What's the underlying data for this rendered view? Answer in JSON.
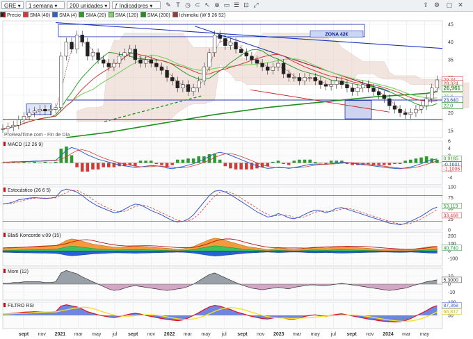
{
  "toolbar": {
    "symbol": "GRE",
    "timeframe": "1 semana",
    "units": "200 unidades",
    "indicators": "Indicadores"
  },
  "legend": [
    {
      "label": "Precio",
      "color": "#222222"
    },
    {
      "label": "SMA (40)",
      "color": "#d23a3a"
    },
    {
      "label": "SMA (4)",
      "color": "#2b62c4"
    },
    {
      "label": "SMA (20)",
      "color": "#2c9b2c"
    },
    {
      "label": "SMA (120)",
      "color": "#7fd36a"
    },
    {
      "label": "SMA (200)",
      "color": "#1f8f1f"
    },
    {
      "label": "Ichimoku (W 9 26 52)",
      "color": "#9a3b3b"
    }
  ],
  "colors": {
    "price": "#111111",
    "sma40": "#d23a3a",
    "sma4": "#2b62c4",
    "sma20": "#2c9b2c",
    "sma120": "#7fd36a",
    "sma200": "#1f8f1f",
    "kumo": "#e8cfc4",
    "trendline": "#1d35b8",
    "support": "#d40000",
    "zona": "#c9d6f5"
  },
  "chart_data": [
    {
      "type": "line",
      "panel": "price",
      "watermark": "ProRealTime.com - Fin de Día",
      "annotation": "ZONA 42€",
      "ylim": [
        13,
        46
      ],
      "yticks": [
        15,
        20,
        25,
        30,
        35,
        40,
        45
      ],
      "xlabels": [
        "sept",
        "nov",
        "2021",
        "mar",
        "may",
        "jul",
        "sept",
        "nov",
        "2022",
        "mar",
        "may",
        "jul",
        "sept",
        "nov",
        "2023",
        "mar",
        "may",
        "jul",
        "sept",
        "nov",
        "2024",
        "mar",
        "may"
      ],
      "value_labels": [
        "29,34",
        "28,324",
        "26,961",
        "24,8",
        "23,640",
        "22,0"
      ],
      "series": [
        {
          "name": "Precio",
          "x": [
            0,
            2,
            4,
            6,
            8,
            10,
            12,
            14,
            16,
            18,
            20,
            22,
            24,
            26,
            28,
            30,
            32,
            34,
            36,
            38,
            40,
            42,
            44,
            46,
            48,
            50,
            52,
            54,
            56,
            58,
            60,
            62,
            64,
            66,
            68,
            70,
            72,
            74,
            76,
            78,
            80,
            82,
            84,
            86,
            88,
            90,
            92,
            94,
            96,
            98,
            100,
            102,
            104,
            106,
            108,
            110,
            112,
            114,
            116,
            118,
            120,
            122,
            124,
            126,
            128,
            130,
            132,
            134,
            136,
            138,
            140,
            142,
            144,
            146,
            148,
            150,
            152,
            154,
            156,
            158,
            160,
            162,
            164
          ],
          "values": [
            15.5,
            16,
            16.5,
            18,
            19,
            20,
            20.5,
            21,
            20.5,
            21,
            21.5,
            36,
            40,
            38,
            42,
            40,
            36,
            37,
            35,
            34,
            33,
            34,
            36,
            37,
            38,
            35,
            34,
            35,
            34,
            33,
            32,
            30,
            29,
            27,
            28,
            26,
            27,
            29,
            33,
            37,
            42,
            41,
            39,
            40,
            38,
            37,
            36,
            35,
            34,
            33,
            32,
            33,
            34,
            31,
            30,
            30,
            29,
            30,
            30,
            29,
            28,
            27.5,
            28,
            29,
            28,
            27,
            26,
            27,
            28,
            27,
            26,
            25,
            24,
            22,
            21,
            20,
            19.5,
            20,
            21,
            22,
            24,
            27,
            29.3
          ]
        },
        {
          "name": "SMA (200)",
          "x": [
            24,
            40,
            60,
            80,
            100,
            120,
            140,
            160,
            164
          ],
          "values": [
            13,
            14.5,
            17,
            19.5,
            21.5,
            23,
            24.5,
            25.5,
            26
          ]
        }
      ]
    },
    {
      "type": "bar",
      "panel": "MACD (12 26 9)",
      "value_labels": [
        "0,9185",
        "-0,1601",
        "-1,1006"
      ],
      "ylim": [
        -6,
        6
      ],
      "yticks": [
        6,
        4,
        2,
        0,
        -2,
        -4
      ],
      "values": [
        0.2,
        0.2,
        0.3,
        0.3,
        0.4,
        0.4,
        0.5,
        0.5,
        0.6,
        0.6,
        0.7,
        2,
        3.5,
        4.2,
        3.8,
        3,
        2.2,
        1.6,
        1,
        0.6,
        0.2,
        -0.2,
        -0.5,
        -0.8,
        -1,
        -1.3,
        -1.1,
        -0.9,
        -0.7,
        -0.8,
        -1,
        -1.4,
        -1.6,
        -1.3,
        -1,
        -0.6,
        -0.2,
        0.4,
        1,
        1.8,
        2.6,
        2.9,
        2.6,
        2.1,
        1.5,
        0.9,
        0.3,
        -0.3,
        -0.8,
        -1.2,
        -1.5,
        -1.4,
        -1.2,
        -1.3,
        -1.5,
        -1.3,
        -1,
        -0.7,
        -0.4,
        -0.3,
        -0.3,
        -0.4,
        -0.2,
        0,
        0.2,
        0.1,
        -0.1,
        -0.3,
        -0.5,
        -0.6,
        -0.8,
        -1,
        -1.2,
        -1.4,
        -1.5,
        -1.6,
        -1.4,
        -1.1,
        -0.7,
        -0.2,
        0.4,
        0.8,
        1.1
      ]
    },
    {
      "type": "line",
      "panel": "Estocástico (26 6 5)",
      "value_labels": [
        "53,119",
        "33,468"
      ],
      "ylim": [
        0,
        100
      ],
      "yticks": [
        100,
        75,
        50,
        25,
        0
      ],
      "values": [
        60,
        62,
        65,
        70,
        72,
        74,
        75,
        74,
        73,
        74,
        76,
        90,
        95,
        92,
        88,
        80,
        70,
        62,
        55,
        50,
        45,
        40,
        42,
        48,
        55,
        60,
        58,
        52,
        45,
        40,
        35,
        28,
        22,
        18,
        20,
        25,
        35,
        50,
        65,
        80,
        90,
        92,
        88,
        82,
        74,
        66,
        58,
        50,
        42,
        36,
        30,
        32,
        38,
        34,
        28,
        26,
        30,
        36,
        42,
        46,
        44,
        40,
        44,
        50,
        52,
        48,
        44,
        40,
        36,
        32,
        28,
        24,
        20,
        16,
        14,
        12,
        15,
        20,
        26,
        32,
        40,
        48,
        53
      ]
    },
    {
      "type": "area",
      "panel": "Blai5 Koncorde v.09 (15)",
      "value_labels": [
        "40,740"
      ],
      "ylim": [
        -200,
        250
      ],
      "yticks": [
        200,
        100,
        0,
        -100
      ],
      "values": [
        10,
        15,
        20,
        25,
        30,
        30,
        35,
        40,
        40,
        45,
        50,
        80,
        120,
        140,
        130,
        110,
        90,
        70,
        60,
        50,
        40,
        30,
        30,
        35,
        40,
        45,
        40,
        35,
        30,
        25,
        20,
        15,
        10,
        5,
        10,
        20,
        40,
        70,
        100,
        130,
        150,
        140,
        120,
        100,
        80,
        60,
        40,
        30,
        20,
        10,
        0,
        10,
        20,
        15,
        5,
        0,
        5,
        15,
        25,
        30,
        25,
        20,
        25,
        35,
        40,
        35,
        30,
        25,
        20,
        15,
        10,
        5,
        0,
        -5,
        -10,
        -15,
        -10,
        0,
        10,
        20,
        30,
        40,
        40.7
      ]
    },
    {
      "type": "bar",
      "panel": "Mom (12)",
      "value_labels": [
        "5,3000"
      ],
      "ylim": [
        -20,
        20
      ],
      "yticks": [
        10,
        0,
        -10
      ],
      "values": [
        1,
        1,
        2,
        2,
        3,
        3,
        3,
        3,
        2,
        2,
        3,
        14,
        17,
        15,
        13,
        9,
        6,
        3,
        0,
        -3,
        -6,
        -8,
        -7,
        -5,
        -3,
        -2,
        -3,
        -4,
        -5,
        -6,
        -7,
        -8,
        -7,
        -6,
        -5,
        -3,
        0,
        4,
        8,
        12,
        14,
        11,
        8,
        5,
        2,
        -1,
        -3,
        -5,
        -6,
        -7,
        -6,
        -5,
        -4,
        -5,
        -6,
        -4,
        -3,
        -2,
        -1,
        -1,
        -2,
        -2,
        -1,
        0,
        1,
        0,
        -1,
        -2,
        -3,
        -4,
        -5,
        -6,
        -7,
        -8,
        -7,
        -6,
        -5,
        -3,
        -1,
        1,
        3,
        4,
        5.3
      ]
    },
    {
      "type": "area",
      "panel": "FILTRO RSI",
      "value_labels": [
        "87,368",
        "66,817"
      ],
      "ylim": [
        0,
        100
      ],
      "yticks": [
        100,
        50
      ],
      "values": [
        55,
        56,
        58,
        60,
        62,
        63,
        64,
        63,
        62,
        63,
        64,
        85,
        90,
        86,
        82,
        74,
        64,
        58,
        52,
        48,
        44,
        42,
        45,
        50,
        55,
        58,
        55,
        50,
        46,
        42,
        38,
        35,
        32,
        30,
        33,
        40,
        50,
        60,
        72,
        82,
        88,
        85,
        78,
        72,
        64,
        58,
        52,
        46,
        42,
        38,
        36,
        40,
        44,
        40,
        36,
        36,
        40,
        46,
        50,
        52,
        48,
        46,
        50,
        54,
        56,
        52,
        48,
        44,
        40,
        36,
        34,
        30,
        28,
        26,
        25,
        26,
        30,
        38,
        48,
        58,
        68,
        80,
        87
      ]
    }
  ]
}
